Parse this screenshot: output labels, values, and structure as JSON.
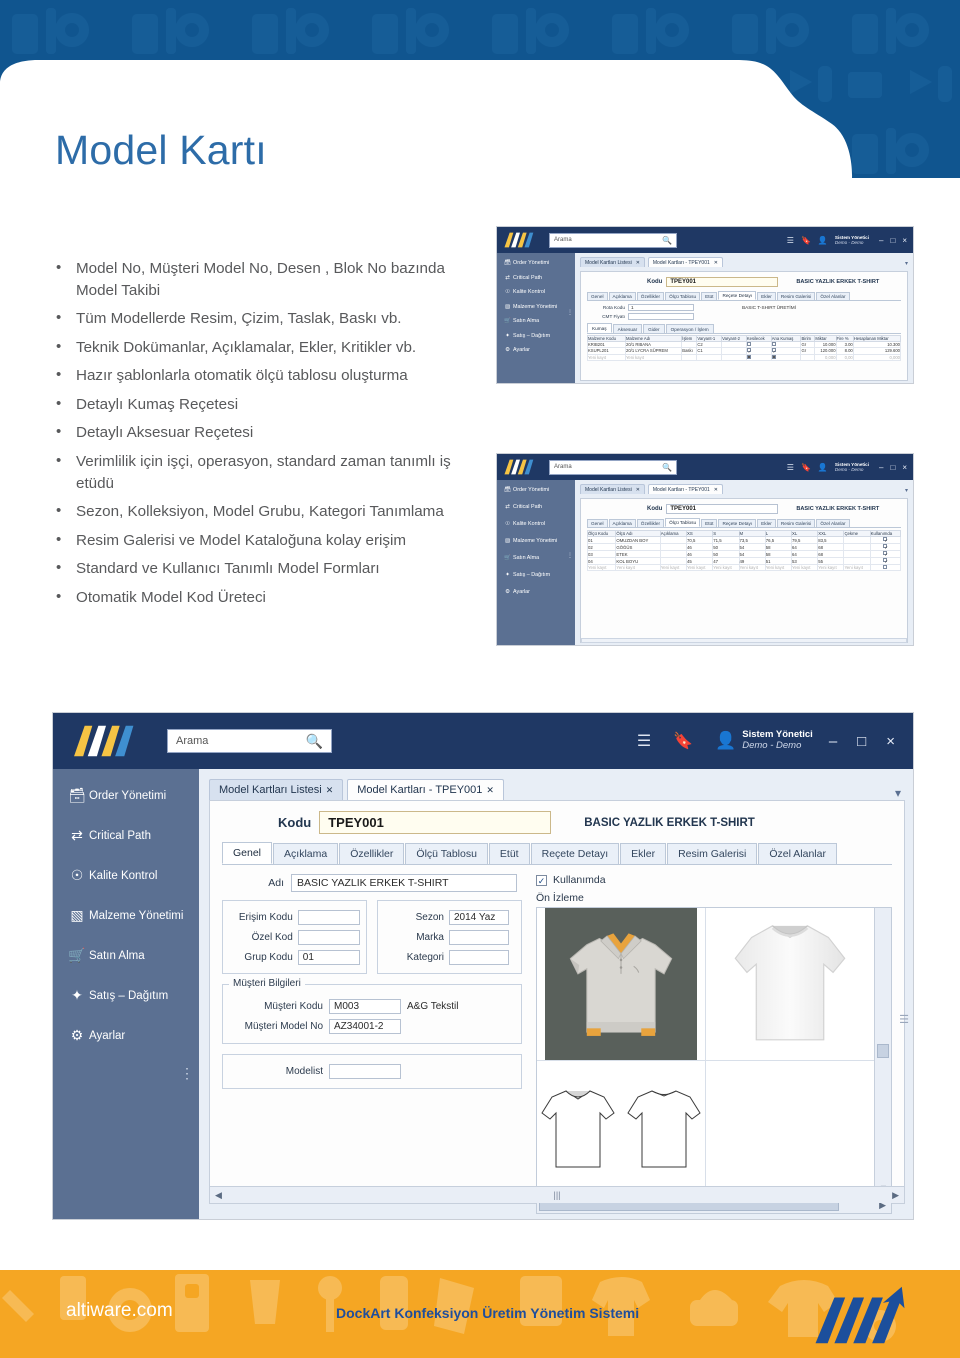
{
  "page": {
    "title": "Model Kartı",
    "title_color": "#2d6ca8",
    "banner_color": "#10558f",
    "banner_color_dark": "#0d4d82",
    "footer_color": "#f5a623"
  },
  "bullets": [
    "Model No, Müşteri Model No, Desen , Blok No bazında Model Takibi",
    "Tüm Modellerde Resim, Çizim, Taslak, Baskı vb.",
    "Teknik Dokümanlar, Açıklamalar, Ekler, Kritikler vb.",
    "Hazır şablonlarla otomatik ölçü tablosu oluşturma",
    "Detaylı Kumaş Reçetesi",
    "Detaylı Aksesuar Reçetesi",
    "Verimlilik için işçi, operasyon, standard zaman tanımlı iş etüdü",
    "Sezon, Kolleksiyon, Model Grubu, Kategori Tanımlama",
    "Resim Galerisi ve Model Kataloğuna kolay erişim",
    "Standard ve Kullanıcı Tanımlı Model Formları",
    "Otomatik Model Kod Üreteci"
  ],
  "app": {
    "logo_text": "AW",
    "search_placeholder": "Arama",
    "search_value": "",
    "user": {
      "name": "Sistem Yönetici",
      "role": "Demo - Demo"
    },
    "window_buttons": {
      "minimize": "–",
      "maximize": "□",
      "close": "×"
    },
    "titlebar_icons": [
      "menu-icon",
      "bookmark-icon",
      "user-icon"
    ],
    "sidebar": [
      {
        "label": "Order Yönetimi",
        "icon": "orders-icon"
      },
      {
        "label": "Critical Path",
        "icon": "critical-path-icon"
      },
      {
        "label": "Kalite Kontrol",
        "icon": "quality-icon"
      },
      {
        "label": "Malzeme Yönetimi",
        "icon": "material-icon"
      },
      {
        "label": "Satın Alma",
        "icon": "basket-icon"
      },
      {
        "label": "Satış – Dağıtım",
        "icon": "sales-icon"
      },
      {
        "label": "Ayarlar",
        "icon": "gear-icon"
      }
    ],
    "doc_tabs": [
      {
        "label": "Model Kartları Listesi",
        "active": false
      },
      {
        "label": "Model Kartları - TPEY001",
        "active": true
      }
    ],
    "kodu_label": "Kodu",
    "kodu_value": "TPEY001",
    "model_name": "BASIC YAZLIK ERKEK T-SHIRT",
    "form_tabs": [
      "Genel",
      "Açıklama",
      "Özellikler",
      "Ölçü Tablosu",
      "Etüt",
      "Reçete Detayı",
      "Ekler",
      "Resim Galerisi",
      "Özel Alanlar"
    ],
    "genel": {
      "adi_label": "Adı",
      "adi_value": "BASIC YAZLIK ERKEK T-SHIRT",
      "kullanimda_label": "Kullanımda",
      "kullanimda_checked": true,
      "onizleme_label": "Ön İzleme",
      "left_fields": [
        {
          "label": "Erişim Kodu",
          "value": ""
        },
        {
          "label": "Özel Kod",
          "value": ""
        },
        {
          "label": "Grup Kodu",
          "value": "01"
        }
      ],
      "right_fields": [
        {
          "label": "Sezon",
          "value": "2014 Yaz"
        },
        {
          "label": "Marka",
          "value": ""
        },
        {
          "label": "Kategori",
          "value": ""
        }
      ],
      "musteri_group_title": "Müşteri Bilgileri",
      "musteri_fields": [
        {
          "label": "Müşteri Kodu",
          "value": "M003",
          "note": "A&G Tekstil"
        },
        {
          "label": "Müşteri Model No",
          "value": "AZ34001-2",
          "note": ""
        }
      ],
      "modelist_label": "Modelist",
      "modelist_value": ""
    }
  },
  "thumb_recete": {
    "active_form_tab": "Reçete Detayı",
    "rota_kodu_label": "Rota Kodu",
    "rota_kodu_value": "1",
    "rota_adi": "BASIC T-SHIRT ÜRETİMİ",
    "cmt_fiyati_label": "CMT Fiyatı",
    "cmt_fiyati_value": "",
    "sub_tabs": [
      "Kumaş",
      "Aksesuar",
      "Gider",
      "Operasyon / İşlem"
    ],
    "active_sub_tab": "Kumaş",
    "columns": [
      "Malzeme Kodu",
      "Malzeme Adı",
      "İşlem",
      "Varyant-1",
      "Varyant-2",
      "Kesilecek",
      "Ana Kumaş",
      "Birim",
      "Miktar",
      "Fire %",
      "Hesaplanan Miktar"
    ],
    "rows": [
      {
        "cells": [
          "KRIB201",
          "20/1 RIBANA",
          "",
          "C2",
          "",
          "",
          "",
          "Gr",
          "10.000",
          "3.00",
          "10.300"
        ],
        "kesilecek": false,
        "ana_kumas": false
      },
      {
        "cells": [
          "KSUPL201",
          "20/1 LYCRA SÜPREM",
          "Baskı",
          "C1",
          "",
          "",
          "",
          "Gr",
          "120.000",
          "8.00",
          "129.600"
        ],
        "kesilecek": true,
        "ana_kumas": true
      },
      {
        "cells": [
          "Yeni kayıt",
          "Yeni kayıt",
          "",
          "",
          "",
          "",
          "",
          "",
          "0,000",
          "0,00",
          "0,000"
        ],
        "kesilecek": null,
        "ana_kumas": null,
        "muted": true
      }
    ]
  },
  "thumb_olcu": {
    "active_form_tab": "Ölçü Tablosu",
    "columns": [
      "Ölçü Kodu",
      "Ölçü Adı",
      "Açıklama",
      "XS",
      "S",
      "M",
      "L",
      "XL",
      "XXL",
      "Çekme",
      "Kullanımda"
    ],
    "rows": [
      {
        "cells": [
          "01",
          "OMUZDAN BOY",
          "",
          "70,5",
          "71,5",
          "73,5",
          "76,5",
          "79,5",
          "83,5",
          ""
        ],
        "kullanimda": true
      },
      {
        "cells": [
          "02",
          "GÖĞÜS",
          "",
          "46",
          "50",
          "54",
          "58",
          "64",
          "68",
          ""
        ],
        "kullanimda": true
      },
      {
        "cells": [
          "03",
          "ETEK",
          "",
          "46",
          "50",
          "54",
          "58",
          "64",
          "68",
          ""
        ],
        "kullanimda": true
      },
      {
        "cells": [
          "04",
          "KOL BOYU",
          "",
          "45",
          "47",
          "49",
          "51",
          "53",
          "55",
          ""
        ],
        "kullanimda": true
      },
      {
        "cells": [
          "Yeni kayıt",
          "Yeni kayıt",
          "Yeni kayıt",
          "Yeni kayıt",
          "Yeni kayıt",
          "Yeni kayıt",
          "Yeni kayıt",
          "Yeni kayıt",
          "Yeni kayıt",
          "Yeni kayıt"
        ],
        "kullanimda": false,
        "muted": true
      }
    ]
  },
  "footer": {
    "site": "altiware.com",
    "tagline": "DockArt Konfeksiyon Üretim Yönetim Sistemi",
    "logo_text": "AW"
  }
}
